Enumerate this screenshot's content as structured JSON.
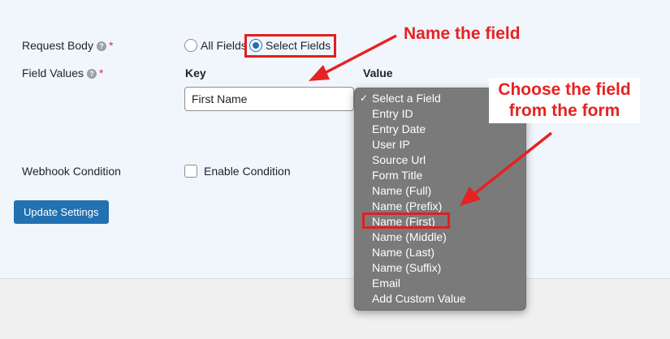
{
  "form": {
    "request_body": {
      "label": "Request Body",
      "required_mark": "*"
    },
    "request_body_options": {
      "all_fields": "All Fields",
      "select_fields": "Select Fields",
      "selected": "Select Fields"
    },
    "field_values": {
      "label": "Field Values",
      "required_mark": "*"
    },
    "columns": {
      "key": "Key",
      "value": "Value"
    },
    "key_input_value": "First Name",
    "webhook_condition": {
      "label": "Webhook Condition",
      "checkbox_label": "Enable Condition",
      "checked": false
    },
    "update_button": "Update Settings",
    "help_icon_glyph": "?"
  },
  "dropdown": {
    "selected_index": 0,
    "check_glyph": "✓",
    "items": [
      "Select a Field",
      "Entry ID",
      "Entry Date",
      "User IP",
      "Source Url",
      "Form Title",
      "Name (Full)",
      "Name (Prefix)",
      "Name (First)",
      "Name (Middle)",
      "Name (Last)",
      "Name (Suffix)",
      "Email",
      "Add Custom Value"
    ],
    "highlighted_item": "Name (First)"
  },
  "annotations": {
    "callout_name": "Name the field",
    "callout_choose_line1": "Choose the field",
    "callout_choose_line2": "from the form",
    "color": "#e62222"
  },
  "colors": {
    "primary": "#2271b1",
    "panel_bg": "#f0f6fc",
    "page_bg": "#f0f0f1",
    "annotation": "#e62222"
  }
}
